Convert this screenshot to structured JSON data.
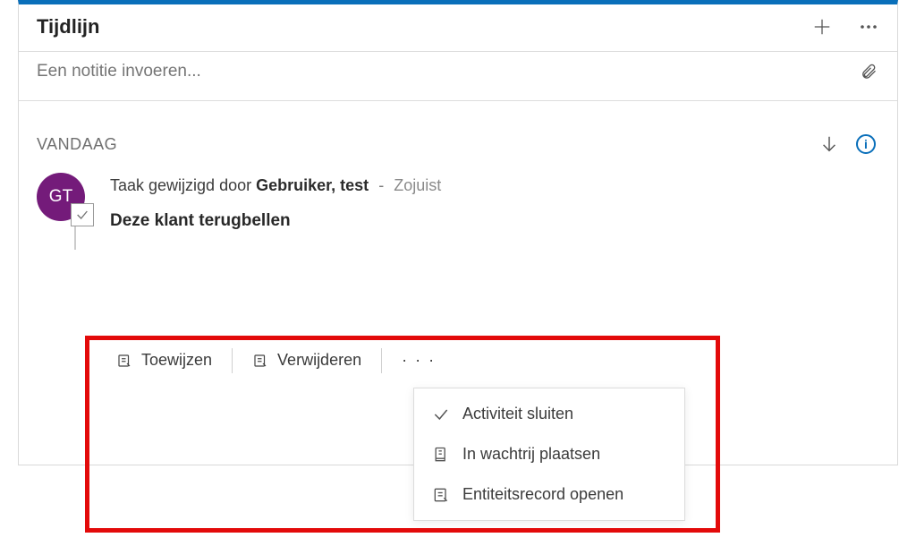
{
  "header": {
    "title": "Tijdlijn"
  },
  "note": {
    "placeholder": "Een notitie invoeren..."
  },
  "section": {
    "label": "VANDAAG"
  },
  "entry": {
    "avatar_initials": "GT",
    "prefix": "Taak gewijzigd door",
    "user": "Gebruiker, test",
    "time": "Zojuist",
    "title": "Deze klant terugbellen"
  },
  "toolbar": {
    "assign": "Toewijzen",
    "delete": "Verwijderen"
  },
  "menu": {
    "close_activity": "Activiteit sluiten",
    "queue": "In wachtrij plaatsen",
    "open_record": "Entiteitsrecord openen"
  }
}
